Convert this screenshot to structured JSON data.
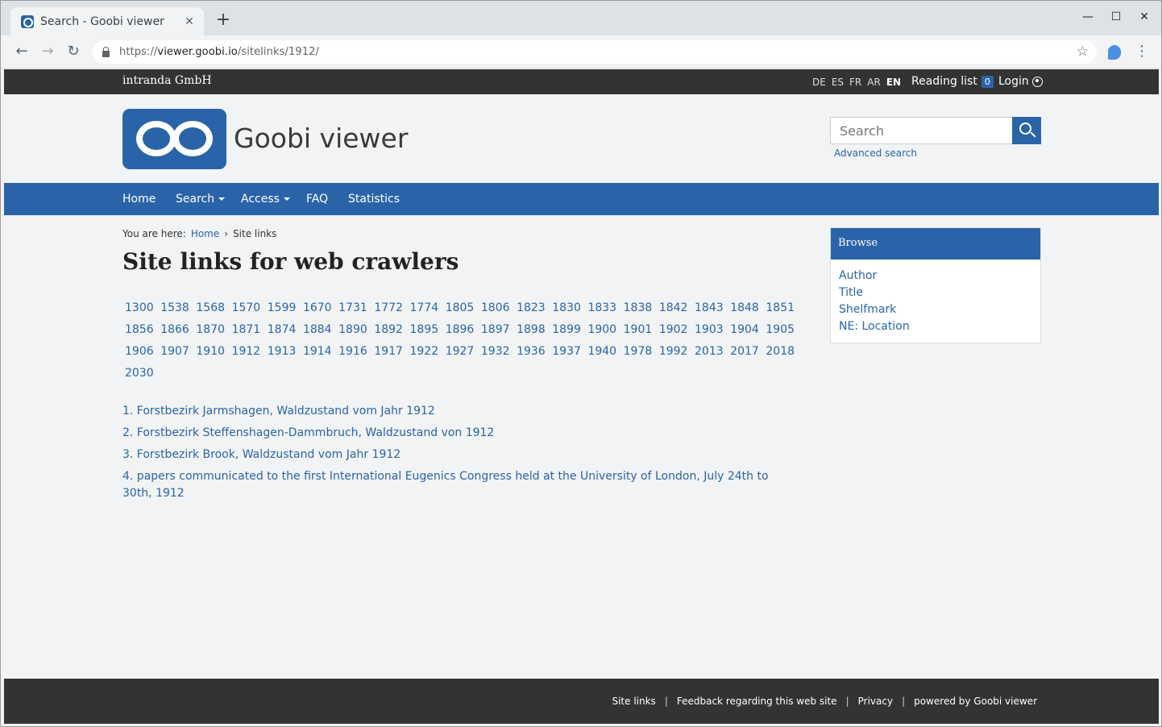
{
  "browser": {
    "tab_title": "Search - Goobi viewer",
    "url_prefix": "https://",
    "url_host": "viewer.goobi.io",
    "url_path": "/sitelinks/1912/",
    "new_tab": "+",
    "tab_close": "✕",
    "minimize": "—",
    "maximize": "☐",
    "close": "✕"
  },
  "topbar": {
    "brand": "intranda GmbH",
    "languages": [
      "DE",
      "ES",
      "FR",
      "AR",
      "EN"
    ],
    "active_language": "EN",
    "reading_list_label": "Reading list",
    "reading_list_count": "0",
    "login_label": "Login"
  },
  "header": {
    "site_title": "Goobi viewer",
    "search_placeholder": "Search",
    "advanced_search": "Advanced search"
  },
  "nav": {
    "items": [
      {
        "label": "Home",
        "dropdown": false
      },
      {
        "label": "Search",
        "dropdown": true
      },
      {
        "label": "Access",
        "dropdown": true
      },
      {
        "label": "FAQ",
        "dropdown": false
      },
      {
        "label": "Statistics",
        "dropdown": false
      }
    ]
  },
  "breadcrumb": {
    "prefix": "You are here:",
    "home": "Home",
    "separator": "›",
    "current": "Site links"
  },
  "main": {
    "title": "Site links for web crawlers",
    "years": [
      "1300",
      "1538",
      "1568",
      "1570",
      "1599",
      "1670",
      "1731",
      "1772",
      "1774",
      "1805",
      "1806",
      "1823",
      "1830",
      "1833",
      "1838",
      "1842",
      "1843",
      "1848",
      "1851",
      "1856",
      "1866",
      "1870",
      "1871",
      "1874",
      "1884",
      "1890",
      "1892",
      "1895",
      "1896",
      "1897",
      "1898",
      "1899",
      "1900",
      "1901",
      "1902",
      "1903",
      "1904",
      "1905",
      "1906",
      "1907",
      "1910",
      "1912",
      "1913",
      "1914",
      "1916",
      "1917",
      "1922",
      "1927",
      "1932",
      "1936",
      "1937",
      "1940",
      "1978",
      "1992",
      "2013",
      "2017",
      "2018",
      "2030"
    ],
    "results": [
      "1. Forstbezirk Jarmshagen, Waldzustand vom Jahr 1912",
      "2. Forstbezirk Steffenshagen-Dammbruch, Waldzustand von 1912",
      "3. Forstbezirk Brook, Waldzustand vom Jahr 1912",
      "4. papers communicated to the first International Eugenics Congress held at the University of London, July 24th to 30th, 1912"
    ]
  },
  "sidebar": {
    "heading": "Browse",
    "items": [
      "Author",
      "Title",
      "Shelfmark",
      "NE: Location"
    ]
  },
  "footer": {
    "links": [
      "Site links",
      "Feedback regarding this web site",
      "Privacy",
      "powered by Goobi viewer"
    ],
    "separator": "|"
  },
  "colors": {
    "brand_blue": "#2a64a8",
    "dark_bar": "#333333",
    "background": "#f1f3f4"
  }
}
